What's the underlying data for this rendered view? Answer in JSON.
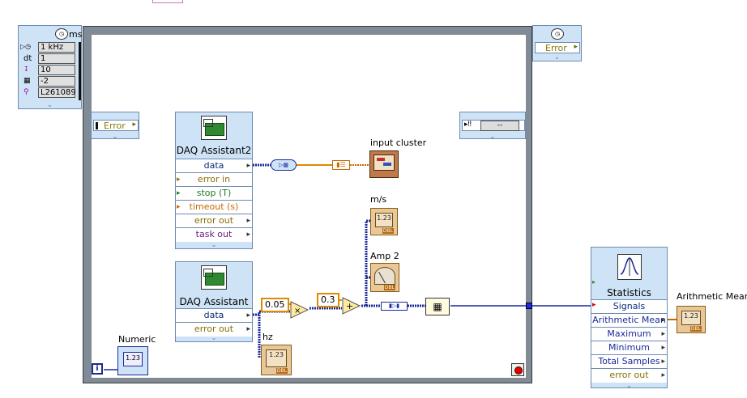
{
  "top_stub": "",
  "timed_loop_config": {
    "header_label": "ms",
    "fields": [
      {
        "icon": "source-icon",
        "value": "1 kHz"
      },
      {
        "icon": "dt-icon",
        "prefix": "dt",
        "value": "1"
      },
      {
        "icon": "offset-icon",
        "value": "10"
      },
      {
        "icon": "priority-icon",
        "value": "-2"
      },
      {
        "icon": "name-icon",
        "value": "L261089"
      }
    ]
  },
  "right_config": {
    "error_label": "Error"
  },
  "left_node": {
    "error_label": "Error"
  },
  "right_inner_node": {
    "value": "--"
  },
  "daq2": {
    "title": "DAQ Assistant2",
    "terminals": [
      {
        "label": "data"
      },
      {
        "label": "error in"
      },
      {
        "label": "stop (T)"
      },
      {
        "label": "timeout (s)"
      },
      {
        "label": "error out"
      },
      {
        "label": "task out"
      }
    ]
  },
  "daq1": {
    "title": "DAQ Assistant",
    "terminals": [
      {
        "label": "data"
      },
      {
        "label": "error out"
      }
    ]
  },
  "input_cluster_label": "input cluster",
  "ms_label": "m/s",
  "amp2_label": "Amp 2",
  "hz_label": "hz",
  "numeric_label": "Numeric",
  "numeric_iter": "i",
  "constants": {
    "c1": "0.05",
    "c2": "0.3"
  },
  "dbl_text": "1.23",
  "dbl_tag": "DBL",
  "statistics": {
    "title": "Statistics",
    "terminals": [
      {
        "label": "Signals"
      },
      {
        "label": "Arithmetic Mean"
      },
      {
        "label": "Maximum"
      },
      {
        "label": "Minimum"
      },
      {
        "label": "Total Samples"
      },
      {
        "label": "error out"
      }
    ]
  },
  "arith_mean_label": "Arithmetic Mean",
  "colors": {
    "node_bg": "#cfe3f7",
    "wire_blue": "#1a2a9a",
    "wire_orange": "#e08a00",
    "loop_frame": "#7f8b97"
  }
}
